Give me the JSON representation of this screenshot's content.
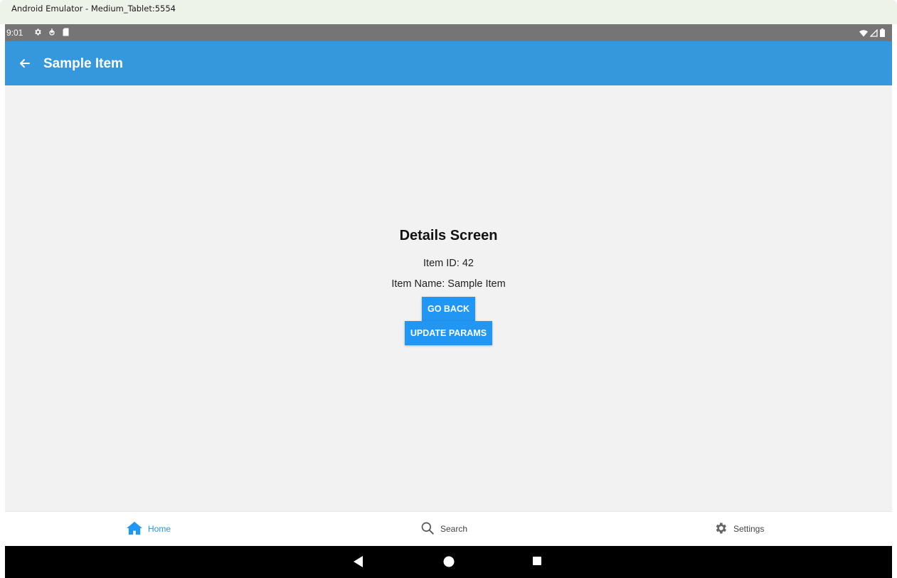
{
  "window": {
    "title": "Android Emulator - Medium_Tablet:5554"
  },
  "status_bar": {
    "time": "9:01",
    "left_icons": [
      "gear-icon",
      "download-icon",
      "sd-card-icon"
    ],
    "right_icons": [
      "wifi-icon",
      "signal-icon",
      "battery-icon"
    ]
  },
  "app_bar": {
    "title": "Sample Item",
    "back_icon": "arrow-left-icon",
    "color": "#3597dc"
  },
  "details": {
    "heading": "Details Screen",
    "item_id": "Item ID: 42",
    "item_name": "Item Name: Sample Item",
    "go_back_label": "GO BACK",
    "update_params_label": "UPDATE PARAMS",
    "button_color": "#2196f3"
  },
  "bottom_nav": {
    "items": [
      {
        "label": "Home",
        "icon": "home-icon",
        "active": true
      },
      {
        "label": "Search",
        "icon": "search-icon",
        "active": false
      },
      {
        "label": "Settings",
        "icon": "gear-icon",
        "active": false
      }
    ],
    "active_color": "#2196f3"
  },
  "system_nav": {
    "icons": [
      "back-triangle-icon",
      "home-circle-icon",
      "recents-square-icon"
    ]
  }
}
